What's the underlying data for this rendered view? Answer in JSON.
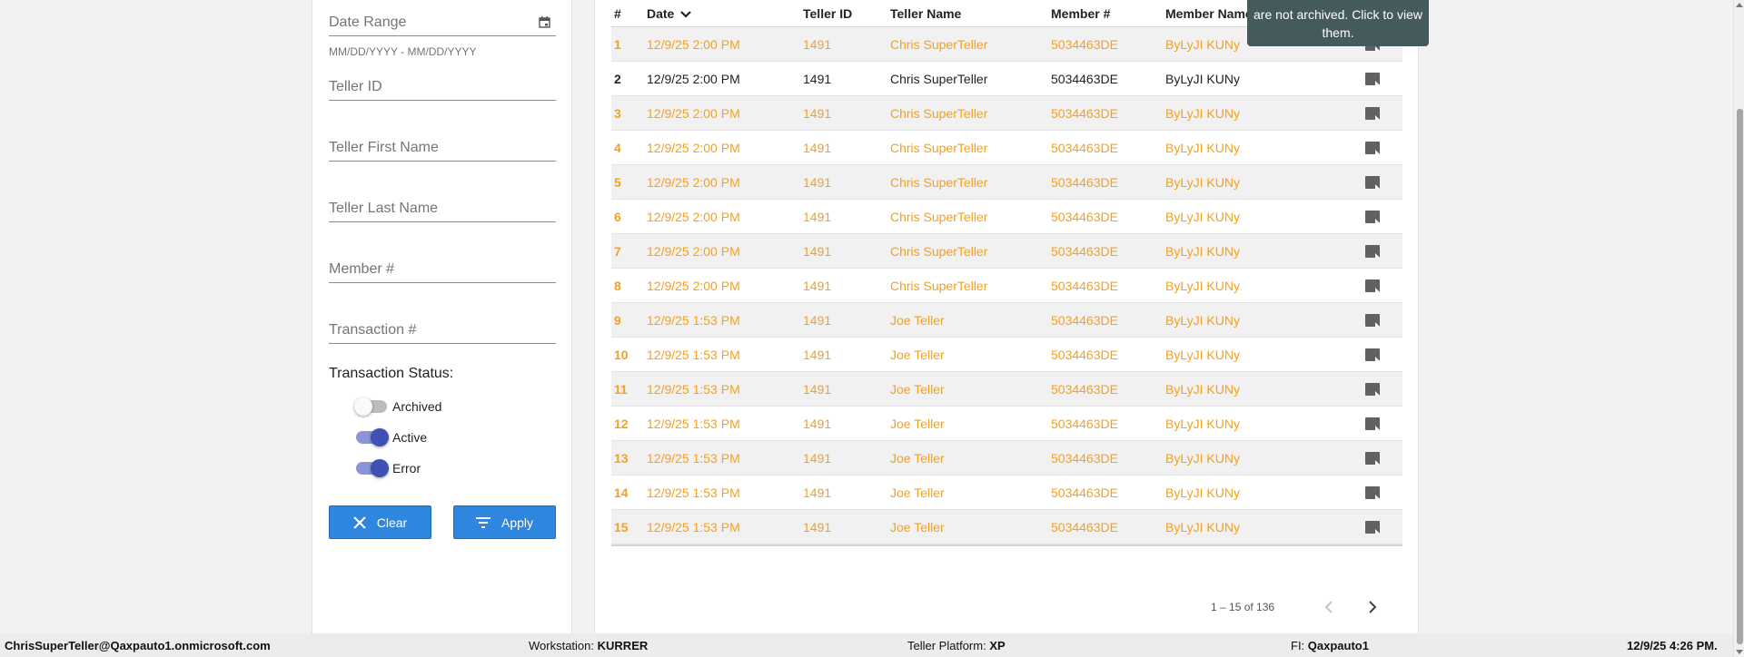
{
  "filters": {
    "date_range_label": "Date Range",
    "date_range_hint": "MM/DD/YYYY - MM/DD/YYYY",
    "teller_id_label": "Teller ID",
    "teller_first_name_label": "Teller First Name",
    "teller_last_name_label": "Teller Last Name",
    "member_label": "Member #",
    "transaction_label": "Transaction #",
    "status_title": "Transaction Status:",
    "toggles": [
      {
        "label": "Archived",
        "on": false
      },
      {
        "label": "Active",
        "on": true
      },
      {
        "label": "Error",
        "on": true
      }
    ],
    "clear_label": "Clear",
    "apply_label": "Apply"
  },
  "grid": {
    "headers": [
      "#",
      "Date",
      "Teller ID",
      "Teller Name",
      "Member #",
      "Member Name"
    ],
    "rows": [
      {
        "num": "1",
        "date": "12/9/25 2:00 PM",
        "teller_id": "1491",
        "teller_name": "Chris SuperTeller",
        "member": "5034463DE",
        "member_name": "ByLyJI KUNy",
        "highlight": true
      },
      {
        "num": "2",
        "date": "12/9/25 2:00 PM",
        "teller_id": "1491",
        "teller_name": "Chris SuperTeller",
        "member": "5034463DE",
        "member_name": "ByLyJI KUNy",
        "highlight": false
      },
      {
        "num": "3",
        "date": "12/9/25 2:00 PM",
        "teller_id": "1491",
        "teller_name": "Chris SuperTeller",
        "member": "5034463DE",
        "member_name": "ByLyJI KUNy",
        "highlight": true
      },
      {
        "num": "4",
        "date": "12/9/25 2:00 PM",
        "teller_id": "1491",
        "teller_name": "Chris SuperTeller",
        "member": "5034463DE",
        "member_name": "ByLyJI KUNy",
        "highlight": true
      },
      {
        "num": "5",
        "date": "12/9/25 2:00 PM",
        "teller_id": "1491",
        "teller_name": "Chris SuperTeller",
        "member": "5034463DE",
        "member_name": "ByLyJI KUNy",
        "highlight": true
      },
      {
        "num": "6",
        "date": "12/9/25 2:00 PM",
        "teller_id": "1491",
        "teller_name": "Chris SuperTeller",
        "member": "5034463DE",
        "member_name": "ByLyJI KUNy",
        "highlight": true
      },
      {
        "num": "7",
        "date": "12/9/25 2:00 PM",
        "teller_id": "1491",
        "teller_name": "Chris SuperTeller",
        "member": "5034463DE",
        "member_name": "ByLyJI KUNy",
        "highlight": true
      },
      {
        "num": "8",
        "date": "12/9/25 2:00 PM",
        "teller_id": "1491",
        "teller_name": "Chris SuperTeller",
        "member": "5034463DE",
        "member_name": "ByLyJI KUNy",
        "highlight": true
      },
      {
        "num": "9",
        "date": "12/9/25 1:53 PM",
        "teller_id": "1491",
        "teller_name": "Joe Teller",
        "member": "5034463DE",
        "member_name": "ByLyJI KUNy",
        "highlight": true
      },
      {
        "num": "10",
        "date": "12/9/25 1:53 PM",
        "teller_id": "1491",
        "teller_name": "Joe Teller",
        "member": "5034463DE",
        "member_name": "ByLyJI KUNy",
        "highlight": true
      },
      {
        "num": "11",
        "date": "12/9/25 1:53 PM",
        "teller_id": "1491",
        "teller_name": "Joe Teller",
        "member": "5034463DE",
        "member_name": "ByLyJI KUNy",
        "highlight": true
      },
      {
        "num": "12",
        "date": "12/9/25 1:53 PM",
        "teller_id": "1491",
        "teller_name": "Joe Teller",
        "member": "5034463DE",
        "member_name": "ByLyJI KUNy",
        "highlight": true
      },
      {
        "num": "13",
        "date": "12/9/25 1:53 PM",
        "teller_id": "1491",
        "teller_name": "Joe Teller",
        "member": "5034463DE",
        "member_name": "ByLyJI KUNy",
        "highlight": true
      },
      {
        "num": "14",
        "date": "12/9/25 1:53 PM",
        "teller_id": "1491",
        "teller_name": "Joe Teller",
        "member": "5034463DE",
        "member_name": "ByLyJI KUNy",
        "highlight": true
      },
      {
        "num": "15",
        "date": "12/9/25 1:53 PM",
        "teller_id": "1491",
        "teller_name": "Joe Teller",
        "member": "5034463DE",
        "member_name": "ByLyJI KUNy",
        "highlight": true
      }
    ],
    "row_icon": "note-icon",
    "sort_icon": "chevron-down-icon"
  },
  "pagination": {
    "range_text": "1 – 15 of 136"
  },
  "tooltip": {
    "text": "are not archived. Click to view them."
  },
  "statusbar": {
    "user": "ChrisSuperTeller@Qaxpauto1.onmicrosoft.com",
    "workstation_label": "Workstation:",
    "workstation_value": "KURRER",
    "platform_label": "Teller Platform:",
    "platform_value": "XP",
    "fi_label": "FI:",
    "fi_value": "Qaxpauto1",
    "datetime": "12/9/25 4:26 PM."
  },
  "colors": {
    "highlight_text": "#f5a01e",
    "button_blue": "#2e86de",
    "toggle_on": "#3f51b5",
    "tooltip_bg": "#455a5c"
  }
}
